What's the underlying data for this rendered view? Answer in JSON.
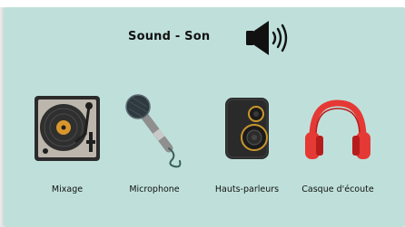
{
  "header": {
    "title": "Sound - Son",
    "icon": "speaker-volume-icon"
  },
  "items": [
    {
      "label": "Mixage",
      "icon": "turntable-icon"
    },
    {
      "label": "Microphone",
      "icon": "microphone-icon"
    },
    {
      "label": "Hauts-parleurs",
      "icon": "loudspeaker-icon"
    },
    {
      "label": "Casque d'écoute",
      "icon": "headphones-icon"
    }
  ],
  "colors": {
    "background": "#bfe0da",
    "headphones": "#e53935",
    "speaker_accent": "#c9962e",
    "mic_head": "#2f3a40"
  }
}
